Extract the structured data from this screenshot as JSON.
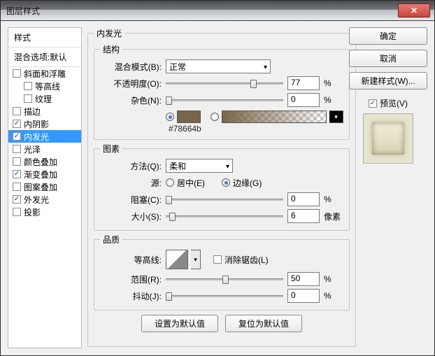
{
  "window": {
    "title": "图层样式"
  },
  "buttons": {
    "ok": "确定",
    "cancel": "取消",
    "newstyle": "新建样式(W)...",
    "setdefault": "设置为默认值",
    "resetdefault": "复位为默认值"
  },
  "preview": {
    "label": "预览(V)"
  },
  "sidebar": {
    "head1": "样式",
    "head2": "混合选项:默认",
    "items": [
      {
        "label": "斜面和浮雕",
        "checked": false
      },
      {
        "label": "等高线",
        "checked": false,
        "indent": true
      },
      {
        "label": "纹理",
        "checked": false,
        "indent": true
      },
      {
        "label": "描边",
        "checked": false
      },
      {
        "label": "内阴影",
        "checked": true
      },
      {
        "label": "内发光",
        "checked": true,
        "selected": true
      },
      {
        "label": "光泽",
        "checked": false
      },
      {
        "label": "颜色叠加",
        "checked": false
      },
      {
        "label": "渐变叠加",
        "checked": true
      },
      {
        "label": "图案叠加",
        "checked": false
      },
      {
        "label": "外发光",
        "checked": true
      },
      {
        "label": "投影",
        "checked": false
      }
    ]
  },
  "panel": {
    "title": "内发光",
    "structure": {
      "legend": "结构",
      "blend_label": "混合模式(B):",
      "blend_value": "正常",
      "opacity_label": "不透明度(O):",
      "opacity_value": "77",
      "opacity_unit": "%",
      "noise_label": "杂色(N):",
      "noise_value": "0",
      "noise_unit": "%",
      "hex_note": "#78664b"
    },
    "elements": {
      "legend": "图素",
      "tech_label": "方法(Q):",
      "tech_value": "柔和",
      "source_label": "源:",
      "source_center": "居中(E)",
      "source_edge": "边缘(G)",
      "choke_label": "阻塞(C):",
      "choke_value": "0",
      "choke_unit": "%",
      "size_label": "大小(S):",
      "size_value": "6",
      "size_unit": "像素"
    },
    "quality": {
      "legend": "品质",
      "contour_label": "等高线:",
      "aa_label": "消除锯齿(L)",
      "range_label": "范围(R):",
      "range_value": "50",
      "range_unit": "%",
      "jitter_label": "抖动(J):",
      "jitter_value": "0",
      "jitter_unit": "%"
    }
  }
}
